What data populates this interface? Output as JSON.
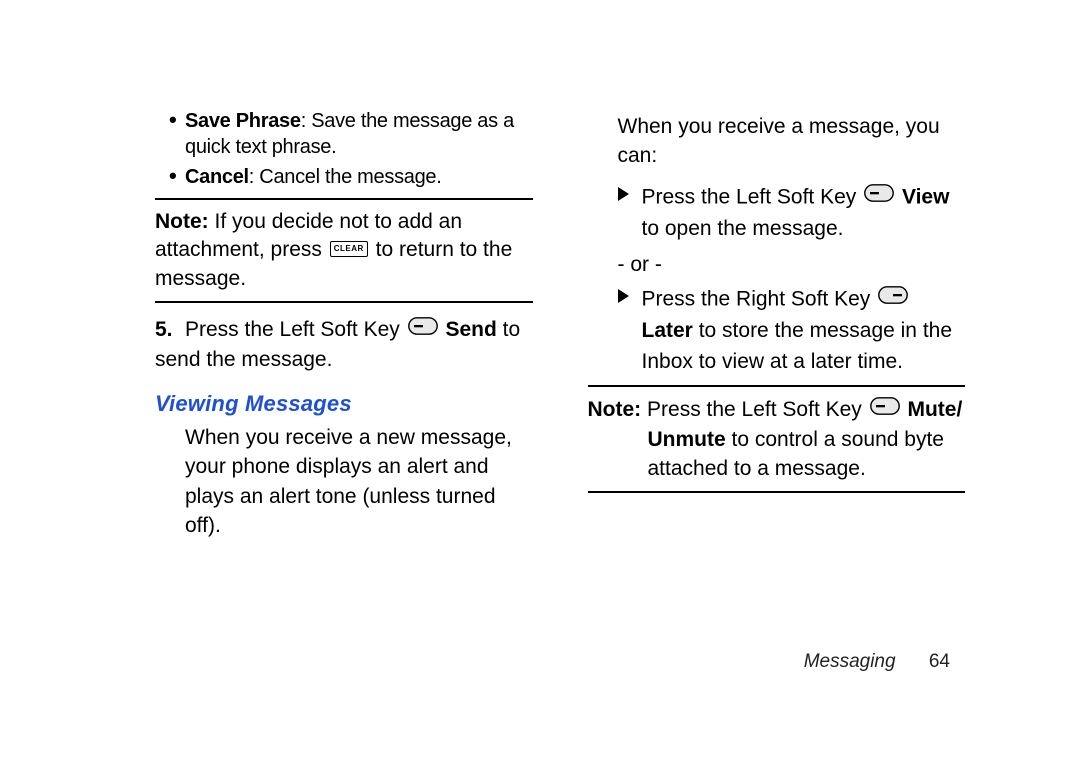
{
  "left": {
    "bullets": [
      {
        "label": "Save Phrase",
        "text": ": Save the message as a quick text phrase."
      },
      {
        "label": "Cancel",
        "text": ": Cancel the message."
      }
    ],
    "note": {
      "label": "Note:",
      "pre": "If you decide not to add an attachment, press",
      "key": "CLEAR",
      "post": "to return to the message."
    },
    "step5": {
      "num": "5.",
      "pre": "Press the Left Soft Key",
      "action": "Send",
      "post": "to send the message."
    },
    "heading": "Viewing Messages",
    "para": "When you receive a new message, your phone displays an alert and plays an alert tone (unless turned off)."
  },
  "right": {
    "intro": "When you receive a message, you can:",
    "item1": {
      "pre": "Press the Left Soft Key",
      "action": "View",
      "post": "to open the message."
    },
    "or": "- or -",
    "item2": {
      "pre": "Press the Right Soft Key",
      "action": "Later",
      "post": "to store the message in the Inbox to view at a later time."
    },
    "note": {
      "label": "Note:",
      "pre": "Press the Left Soft Key",
      "action": "Mute/",
      "action2": "Unmute",
      "post": "to control a sound byte attached to a message."
    }
  },
  "footer": {
    "section": "Messaging",
    "page": "64"
  }
}
